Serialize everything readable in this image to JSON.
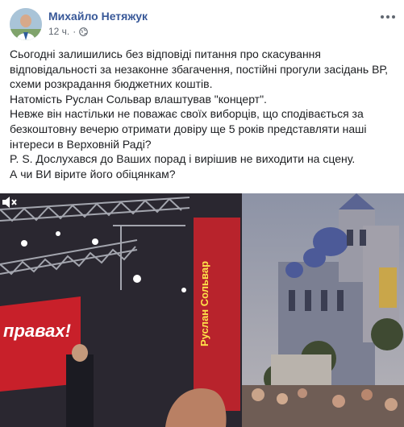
{
  "post": {
    "author": "Михайло Нетяжук",
    "time": "12 ч.",
    "separator": "·",
    "privacy_icon": "globe-icon",
    "more_icon": "more-horizontal-icon",
    "text_lines": [
      "Сьогодні залишились без відповіді питання про скасування",
      "відповідальності за незаконне збагачення, постійні прогули засідань ВР,",
      "схеми розкрадання бюджетних коштів.",
      "Натомість Руслан Сольвар влаштував \"концерт\".",
      "Невже він настільки не поважає своїх виборців, що сподівається за",
      "безкоштовну вечерю отримати довіру ще 5 років представляти наші",
      "інтереси в Верховній Раді?",
      "P. S. Дослухався до Ваших порад і вирішив не виходити на сцену.",
      "А чи ВИ вірите його обіцянкам?"
    ]
  },
  "video": {
    "banner_text": "правах!",
    "side_banner_text": "Руслан Сольвар",
    "mute_icon": "speaker-muted-icon"
  },
  "colors": {
    "author_link": "#385898",
    "meta_text": "#606770",
    "body_text": "#1c1e21",
    "banner_red": "#c8202a"
  }
}
